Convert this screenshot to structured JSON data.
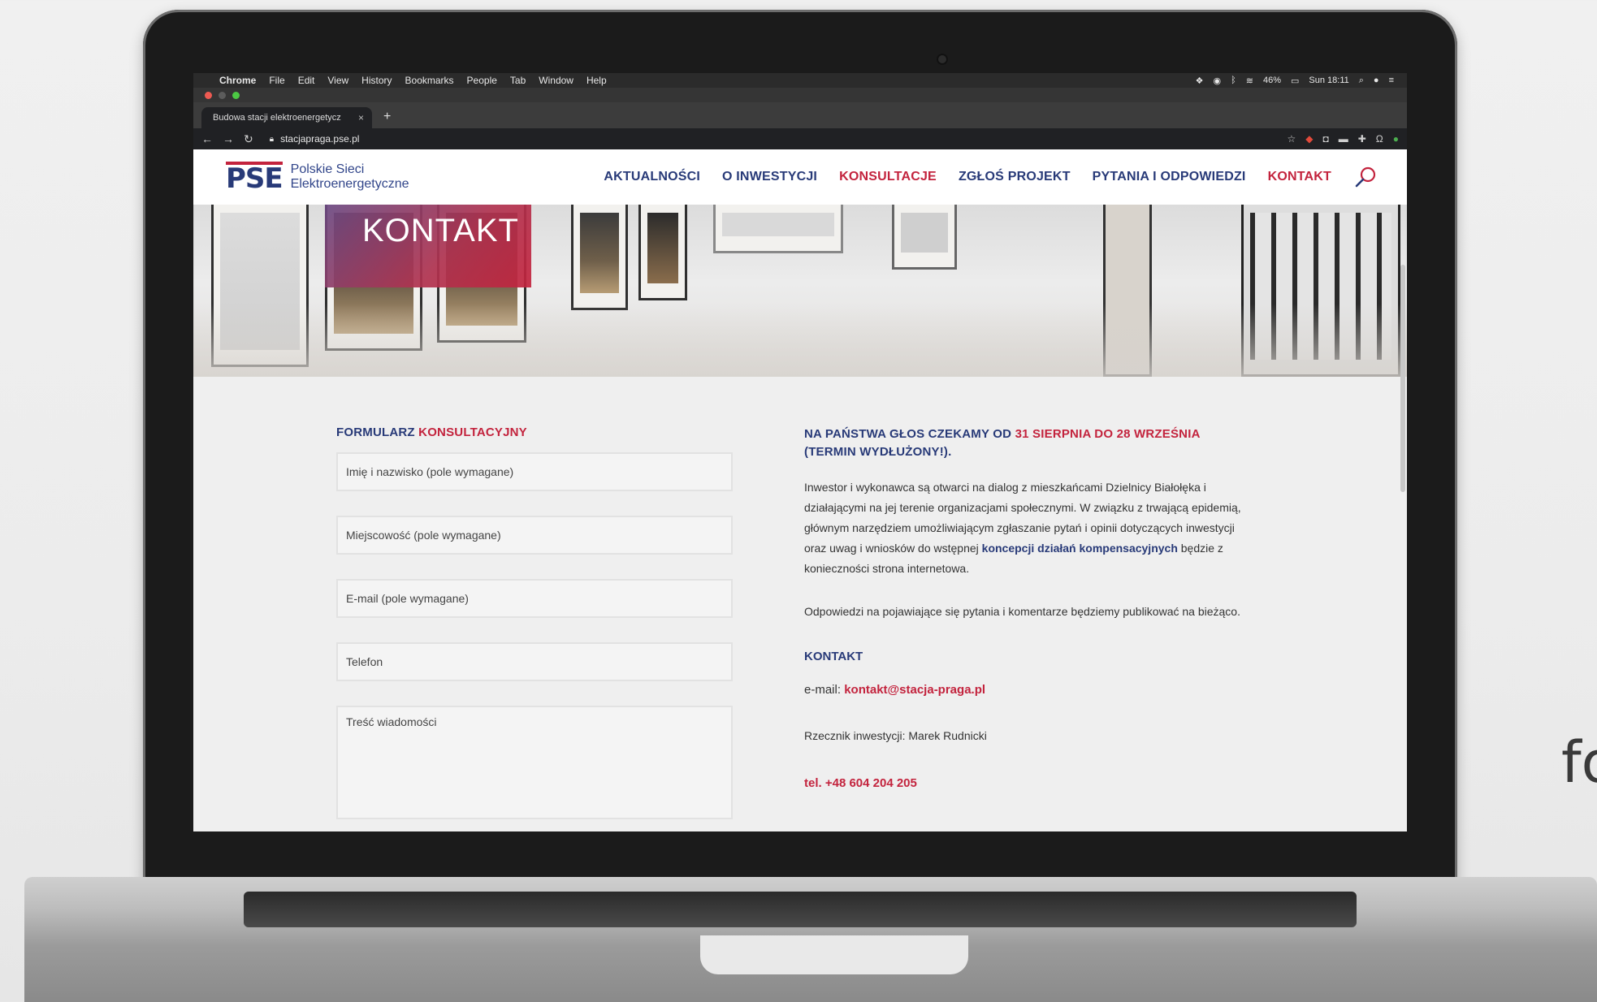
{
  "backdrop": {
    "text": "fo"
  },
  "macos": {
    "apple": "",
    "app": "Chrome",
    "menus": [
      "File",
      "Edit",
      "View",
      "History",
      "Bookmarks",
      "People",
      "Tab",
      "Window",
      "Help"
    ],
    "status": {
      "battery": "46%",
      "clock": "Sun 18:11"
    }
  },
  "browser": {
    "tab_title": "Budowa stacji elektroenergetycz",
    "tab_close": "×",
    "new_tab": "+",
    "url": "stacjapraga.pse.pl"
  },
  "site": {
    "logo_mark": "PSE",
    "logo_line1": "Polskie Sieci",
    "logo_line2": "Elektroenergetyczne",
    "nav": {
      "aktualnosci": "AKTUALNOŚCI",
      "o_inwestycji": "O INWESTYCJI",
      "konsultacje": "KONSULTACJE",
      "zglos_projekt": "ZGŁOŚ PROJEKT",
      "pytania": "PYTANIA I ODPOWIEDZI",
      "kontakt": "KONTAKT"
    },
    "hero_title": "KONTAKT",
    "form": {
      "title_part1": "FORMULARZ",
      "title_part2": "KONSULTACYJNY",
      "name_placeholder": "Imię i nazwisko (pole wymagane)",
      "city_placeholder": "Miejscowość (pole wymagane)",
      "email_placeholder": "E-mail (pole wymagane)",
      "phone_placeholder": "Telefon",
      "message_placeholder": "Treść wiadomości"
    },
    "info": {
      "title_part1": "NA PAŃSTWA GŁOS CZEKAMY OD",
      "title_dates": "31 SIERPNIA DO 28 WRZEŚNIA",
      "title_part2": "(TERMIN WYDŁUŻONY!).",
      "para1_text": "Inwestor i wykonawca są otwarci na dialog z mieszkańcami Dzielnicy Białołęka i działającymi na jej terenie organizacjami społecznymi. W związku z trwającą epidemią, głównym narzędziem umożliwiającym zgłaszanie pytań i opinii dotyczących inwestycji oraz uwag i wniosków do wstępnej",
      "para1_link": "koncepcji działań kompensacyjnych",
      "para1_end": "będzie z konieczności strona internetowa.",
      "para2": "Odpowiedzi na pojawiające się pytania i komentarze będziemy publikować na bieżąco.",
      "kontakt_heading": "KONTAKT",
      "email_label": "e-mail:",
      "email_value": "kontakt@stacja-praga.pl",
      "rzecznik": "Rzecznik inwestycji: Marek Rudnicki",
      "phone": "tel. +48 604 204 205"
    }
  },
  "colors": {
    "navy": "#283a78",
    "red": "#c3233d"
  }
}
